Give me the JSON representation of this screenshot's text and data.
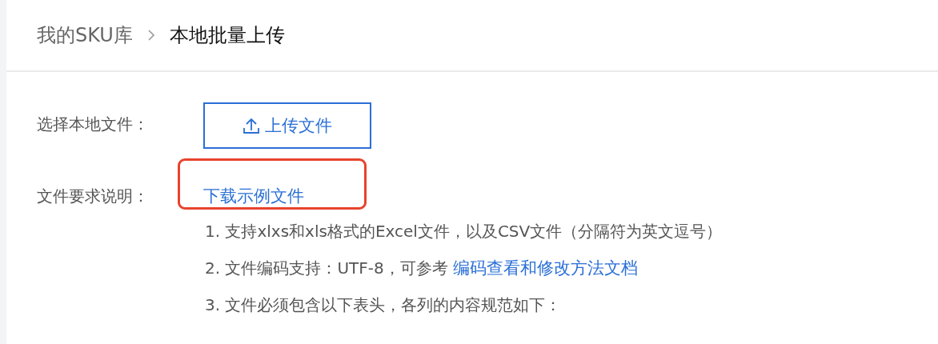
{
  "breadcrumb": [
    {
      "label": "我的SKU库",
      "selected": false
    },
    {
      "label": "本地批量上传",
      "selected": true
    }
  ],
  "form": [
    {
      "kind": "upload",
      "label": "选择本地文件：",
      "button": "上传文件"
    },
    {
      "kind": "requirements",
      "label": "文件要求说明：",
      "link": "下载示例文件",
      "highlighted": true,
      "items": [
        {
          "text": "1. 支持xlxs和xls格式的Excel文件，以及CSV文件（分隔符为英文逗号）"
        },
        {
          "text": "2. 文件编码支持：UTF-8，可参考",
          "link": "编码查看和修改方法文档"
        },
        {
          "text": "3. 文件必须包含以下表头，各列的内容规范如下："
        }
      ]
    }
  ]
}
